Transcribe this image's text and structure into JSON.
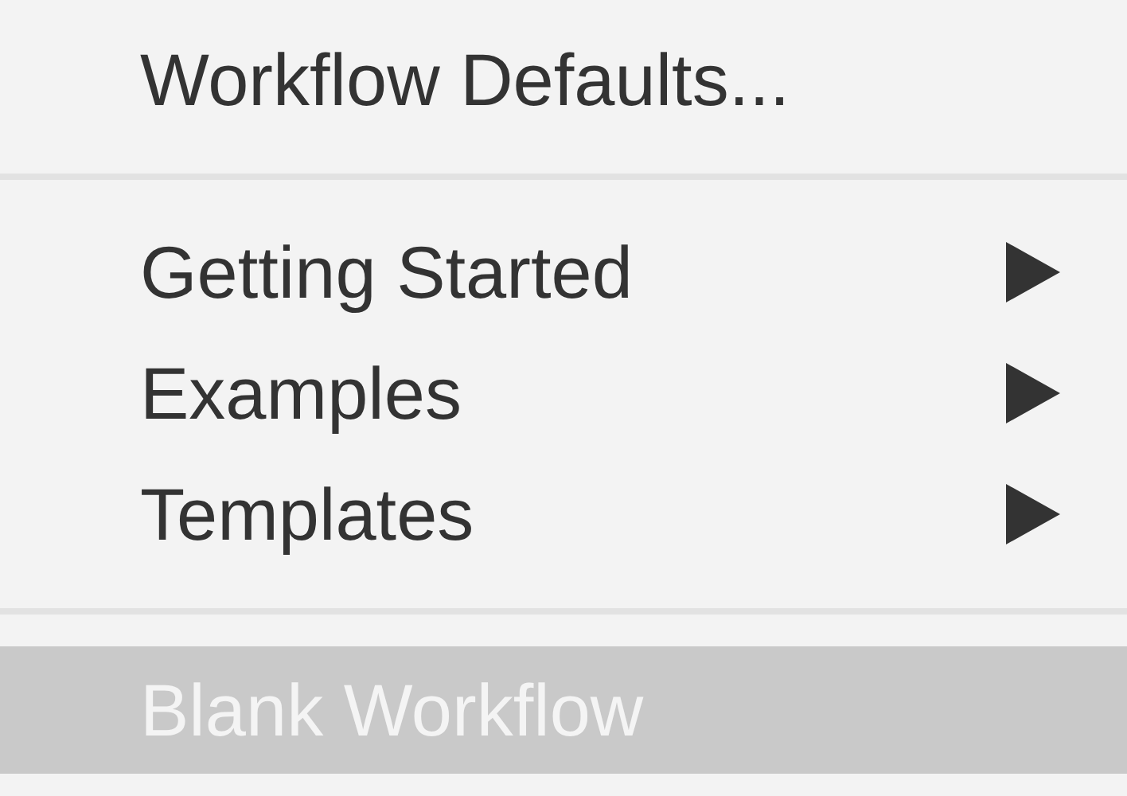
{
  "menu": {
    "items": [
      {
        "kind": "item",
        "label": "Workflow Defaults...",
        "selected": false
      },
      {
        "kind": "separator"
      },
      {
        "kind": "submenu",
        "label": "Getting Started",
        "selected": false
      },
      {
        "kind": "submenu",
        "label": "Examples",
        "selected": false
      },
      {
        "kind": "submenu",
        "label": "Templates",
        "selected": false
      },
      {
        "kind": "separator"
      },
      {
        "kind": "item",
        "label": "Blank Workflow",
        "selected": true
      }
    ]
  }
}
